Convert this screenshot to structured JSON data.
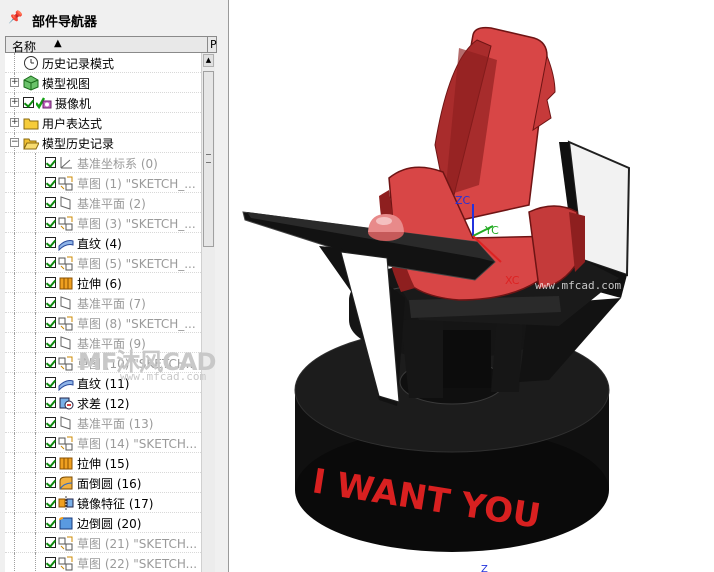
{
  "navigator": {
    "title": "部件导航器",
    "column_name": "名称",
    "column_p": "P"
  },
  "tree": [
    {
      "label": "历史记录模式",
      "icon": "clock-icon",
      "gray": false,
      "level": 0,
      "expander": "",
      "checked": false
    },
    {
      "label": "模型视图",
      "icon": "model-view-icon",
      "gray": false,
      "level": 0,
      "expander": "+",
      "checked": false
    },
    {
      "label": "摄像机",
      "icon": "camera-icon",
      "gray": false,
      "level": 0,
      "expander": "+",
      "checked": true
    },
    {
      "label": "用户表达式",
      "icon": "folder-icon",
      "gray": false,
      "level": 0,
      "expander": "+",
      "checked": false
    },
    {
      "label": "模型历史记录",
      "icon": "folder-open-icon",
      "gray": false,
      "level": 0,
      "expander": "−",
      "checked": false
    },
    {
      "label": "基准坐标系 (0)",
      "icon": "datum-csys-icon",
      "gray": true,
      "level": 1,
      "checked": true
    },
    {
      "label": "草图 (1) \"SKETCH_...",
      "icon": "sketch-icon",
      "gray": true,
      "level": 1,
      "checked": true
    },
    {
      "label": "基准平面 (2)",
      "icon": "datum-plane-icon",
      "gray": true,
      "level": 1,
      "checked": true
    },
    {
      "label": "草图 (3) \"SKETCH_...",
      "icon": "sketch-icon",
      "gray": true,
      "level": 1,
      "checked": true
    },
    {
      "label": "直纹 (4)",
      "icon": "ruled-surface-icon",
      "gray": false,
      "level": 1,
      "checked": true
    },
    {
      "label": "草图 (5) \"SKETCH_...",
      "icon": "sketch-icon",
      "gray": true,
      "level": 1,
      "checked": true
    },
    {
      "label": "拉伸 (6)",
      "icon": "extrude-icon",
      "gray": false,
      "level": 1,
      "checked": true
    },
    {
      "label": "基准平面 (7)",
      "icon": "datum-plane-icon",
      "gray": true,
      "level": 1,
      "checked": true
    },
    {
      "label": "草图 (8) \"SKETCH_...",
      "icon": "sketch-icon",
      "gray": true,
      "level": 1,
      "checked": true
    },
    {
      "label": "基准平面 (9)",
      "icon": "datum-plane-icon",
      "gray": true,
      "level": 1,
      "checked": true
    },
    {
      "label": "草图 (10) \"SKETCH...",
      "icon": "sketch-icon",
      "gray": true,
      "level": 1,
      "checked": true
    },
    {
      "label": "直纹 (11)",
      "icon": "ruled-surface-icon",
      "gray": false,
      "level": 1,
      "checked": true
    },
    {
      "label": "求差 (12)",
      "icon": "subtract-icon",
      "gray": false,
      "level": 1,
      "checked": true
    },
    {
      "label": "基准平面 (13)",
      "icon": "datum-plane-icon",
      "gray": true,
      "level": 1,
      "checked": true
    },
    {
      "label": "草图 (14) \"SKETCH...",
      "icon": "sketch-icon",
      "gray": true,
      "level": 1,
      "checked": true
    },
    {
      "label": "拉伸 (15)",
      "icon": "extrude-icon",
      "gray": false,
      "level": 1,
      "checked": true
    },
    {
      "label": "面倒圆 (16)",
      "icon": "face-blend-icon",
      "gray": false,
      "level": 1,
      "checked": true
    },
    {
      "label": "镜像特征 (17)",
      "icon": "mirror-feature-icon",
      "gray": false,
      "level": 1,
      "checked": true
    },
    {
      "label": "边倒圆 (20)",
      "icon": "edge-blend-icon",
      "gray": false,
      "level": 1,
      "checked": true
    },
    {
      "label": "草图 (21) \"SKETCH...",
      "icon": "sketch-icon",
      "gray": true,
      "level": 1,
      "checked": true
    },
    {
      "label": "草图 (22) \"SKETCH...",
      "icon": "sketch-icon",
      "gray": true,
      "level": 1,
      "checked": true
    }
  ],
  "viewport": {
    "base_text": "I WANT YOU",
    "axis_zc": "ZC",
    "axis_yc": "YC",
    "axis_xc": "XC",
    "axis_z": "Z",
    "watermark_logo": "MF沐风CAD",
    "watermark_url": "www.mfcad.com",
    "watermark_url_short": "www.mfcad.com",
    "colors": {
      "red": "#d84646",
      "red_dark": "#8e1f1f",
      "black": "#101010",
      "axis_blue": "#2233dd",
      "axis_green": "#22aa22",
      "axis_red": "#dd2222"
    }
  }
}
